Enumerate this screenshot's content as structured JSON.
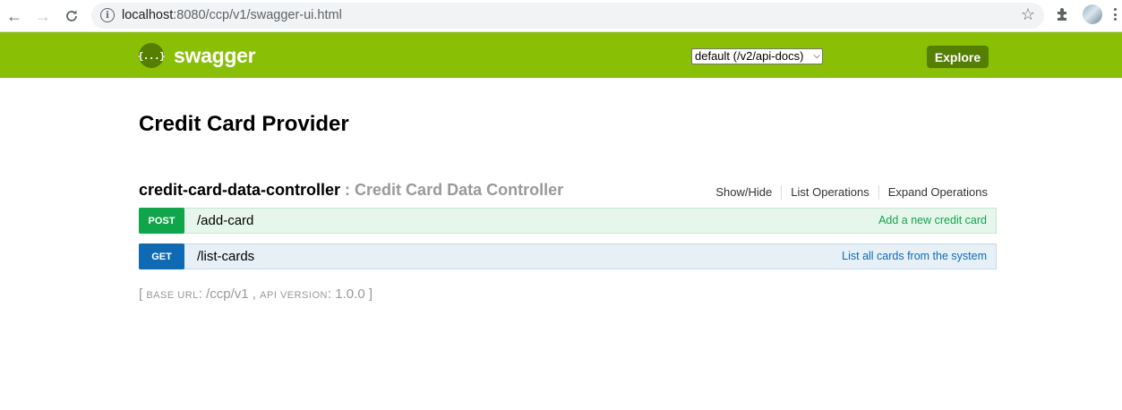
{
  "browser": {
    "url_host": "localhost",
    "url_rest": ":8080/ccp/v1/swagger-ui.html",
    "back_icon": "arrow-left",
    "forward_icon": "arrow-right",
    "reload_icon": "reload",
    "info_icon": "info",
    "star_icon": "star",
    "extensions_icon": "puzzle",
    "menu_icon": "kebab"
  },
  "header": {
    "logo_glyph": "{...}",
    "brand": "swagger",
    "spec_select": "default (/v2/api-docs)",
    "explore_label": "Explore"
  },
  "api": {
    "title": "Credit Card Provider"
  },
  "resource": {
    "name": "credit-card-data-controller",
    "separator": " : ",
    "description": "Credit Card Data Controller",
    "links": [
      "Show/Hide",
      "List Operations",
      "Expand Operations"
    ]
  },
  "operations": [
    {
      "method": "POST",
      "path": "/add-card",
      "summary": "Add a new credit card"
    },
    {
      "method": "GET",
      "path": "/list-cards",
      "summary": "List all cards from the system"
    }
  ],
  "footer": {
    "open": "[ ",
    "base_url_label": "base url",
    "base_url_sep": ": ",
    "base_url": "/ccp/v1",
    "comma": " , ",
    "api_version_label": "api version",
    "api_version_sep": ": ",
    "api_version": "1.0.0",
    "close": " ]"
  },
  "colors": {
    "header_bg": "#89bf04",
    "header_dark": "#547f00",
    "post": "#10a54a",
    "get": "#0f6ab4"
  }
}
